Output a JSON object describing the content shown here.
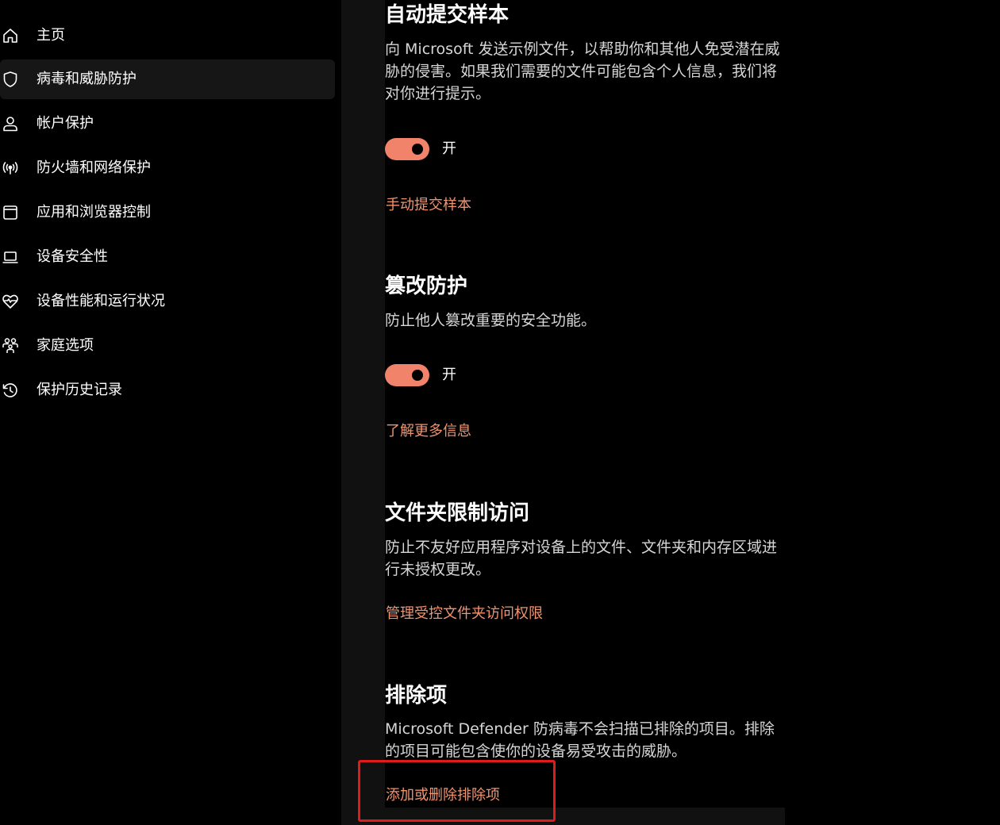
{
  "sidebar": {
    "items": [
      {
        "label": "主页",
        "icon": "home-icon",
        "selected": false
      },
      {
        "label": "病毒和威胁防护",
        "icon": "shield-icon",
        "selected": true
      },
      {
        "label": "帐户保护",
        "icon": "person-icon",
        "selected": false
      },
      {
        "label": "防火墙和网络保护",
        "icon": "wireless-icon",
        "selected": false
      },
      {
        "label": "应用和浏览器控制",
        "icon": "browser-window-icon",
        "selected": false
      },
      {
        "label": "设备安全性",
        "icon": "laptop-icon",
        "selected": false
      },
      {
        "label": "设备性能和运行状况",
        "icon": "heart-pulse-icon",
        "selected": false
      },
      {
        "label": "家庭选项",
        "icon": "family-icon",
        "selected": false
      },
      {
        "label": "保护历史记录",
        "icon": "history-icon",
        "selected": false
      }
    ]
  },
  "sections": {
    "auto_submit": {
      "title": "自动提交样本",
      "description": "向 Microsoft 发送示例文件，以帮助你和其他人免受潜在威胁的侵害。如果我们需要的文件可能包含个人信息，我们将对你进行提示。",
      "toggle_label": "开",
      "toggle_on": true,
      "link": "手动提交样本"
    },
    "tamper": {
      "title": "篡改防护",
      "description": "防止他人篡改重要的安全功能。",
      "toggle_label": "开",
      "toggle_on": true,
      "link": "了解更多信息"
    },
    "folder_access": {
      "title": "文件夹限制访问",
      "description": "防止不友好应用程序对设备上的文件、文件夹和内存区域进行未授权更改。",
      "link": "管理受控文件夹访问权限"
    },
    "exclusions": {
      "title": "排除项",
      "description": "Microsoft Defender 防病毒不会扫描已排除的项目。排除的项目可能包含使你的设备易受攻击的威胁。",
      "link": "添加或删除排除项"
    }
  },
  "colors": {
    "accent": "#f0836a",
    "link": "#f0936f",
    "highlight": "#e01b1b",
    "background": "#000000",
    "selected_bg": "#161616"
  }
}
